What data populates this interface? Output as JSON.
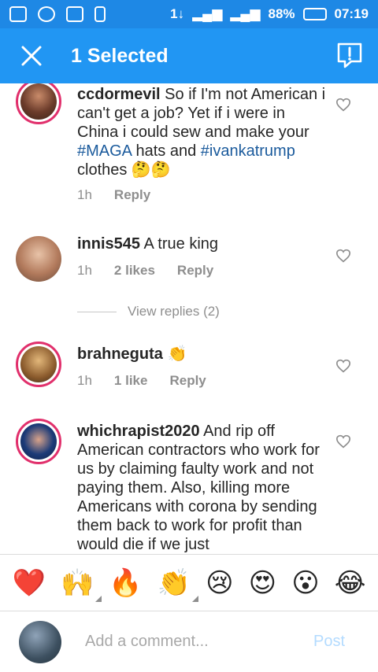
{
  "statusbar": {
    "data_indicator": "1↓",
    "signal1": "H+",
    "battery": "88%",
    "time": "07:19"
  },
  "appbar": {
    "title": "1 Selected"
  },
  "comments": [
    {
      "username": "ccdormevil",
      "text_before": "So if I'm not American i can't get a job? Yet if  i were in China i could sew and make your ",
      "tag1": "#MAGA",
      "text_mid": " hats and ",
      "tag2": "#ivankatrump",
      "text_after": " clothes 🤔🤔",
      "time": "1h",
      "likes": "",
      "reply": "Reply"
    },
    {
      "username": "innis545",
      "text": "A true king",
      "time": "1h",
      "likes": "2 likes",
      "reply": "Reply",
      "view_replies": "View replies (2)"
    },
    {
      "username": "brahneguta",
      "text": "👏",
      "time": "1h",
      "likes": "1 like",
      "reply": "Reply"
    },
    {
      "username": "whichrapist2020",
      "text": "And rip off American contractors who work for us by claiming faulty work and not paying them. Also, killing more Americans with corona by sending them back to work for profit than would die if we just"
    }
  ],
  "reactions": [
    "❤️",
    "🙌",
    "🔥",
    "👏",
    "😢",
    "😍",
    "😮",
    "😂"
  ],
  "composer": {
    "placeholder": "Add a comment...",
    "post_label": "Post"
  },
  "colors": {
    "statusbar": "#1e88e5",
    "appbar": "#2196f3",
    "link": "#1a5a9c",
    "ring": "#e1306c"
  }
}
